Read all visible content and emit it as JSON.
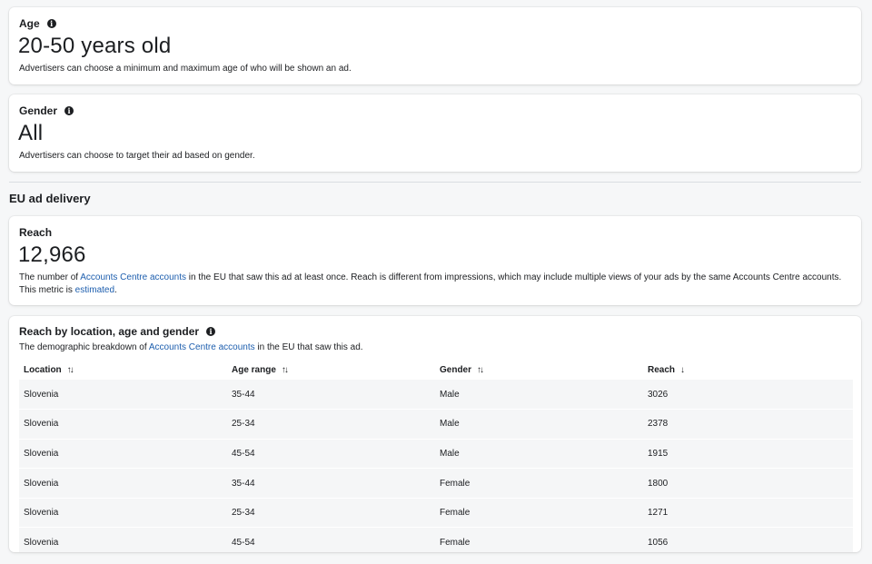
{
  "age": {
    "label": "Age",
    "value": "20-50 years old",
    "description": "Advertisers can choose a minimum and maximum age of who will be shown an ad."
  },
  "gender": {
    "label": "Gender",
    "value": "All",
    "description": "Advertisers can choose to target their ad based on gender."
  },
  "eu_delivery": {
    "heading": "EU ad delivery"
  },
  "reach": {
    "label": "Reach",
    "value": "12,966",
    "desc_part1": "The number of ",
    "desc_link": "Accounts Centre accounts",
    "desc_part2": " in the EU that saw this ad at least once. Reach is different from impressions, which may include multiple views of your ads by the same Accounts Centre accounts. This metric is ",
    "desc_link2": "estimated",
    "desc_part3": "."
  },
  "breakdown": {
    "title": "Reach by location, age and gender",
    "desc_part1": "The demographic breakdown of ",
    "desc_link": "Accounts Centre accounts",
    "desc_part2": " in the EU that saw this ad.",
    "columns": [
      "Location",
      "Age range",
      "Gender",
      "Reach"
    ],
    "sort_icons": [
      "↑↓",
      "↑↓",
      "↑↓",
      "↓"
    ],
    "rows": [
      [
        "Slovenia",
        "35-44",
        "Male",
        "3026"
      ],
      [
        "Slovenia",
        "25-34",
        "Male",
        "2378"
      ],
      [
        "Slovenia",
        "45-54",
        "Male",
        "1915"
      ],
      [
        "Slovenia",
        "35-44",
        "Female",
        "1800"
      ],
      [
        "Slovenia",
        "25-34",
        "Female",
        "1271"
      ],
      [
        "Slovenia",
        "45-54",
        "Female",
        "1056"
      ]
    ]
  }
}
